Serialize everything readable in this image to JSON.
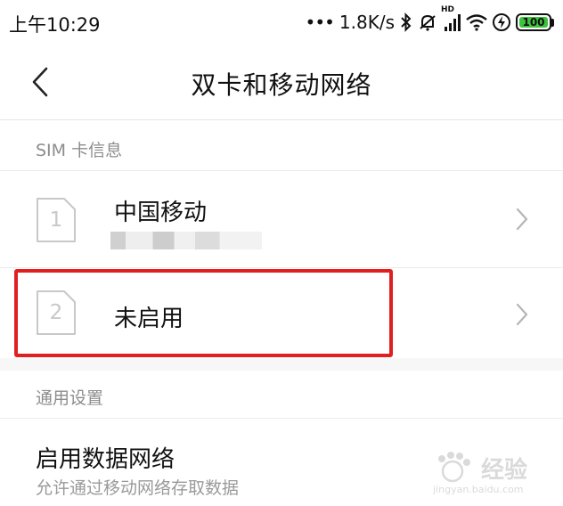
{
  "status_bar": {
    "time": "上午10:29",
    "network_speed": "1.8K/s",
    "signal_label": "HD",
    "battery_level": "100",
    "icons": [
      "dots-icon",
      "bluetooth-icon",
      "mute-icon",
      "signal-icon",
      "wifi-icon",
      "charging-icon",
      "battery-icon"
    ],
    "battery_color": "#3cc43c"
  },
  "header": {
    "title": "双卡和移动网络",
    "back_icon": "chevron-left-icon"
  },
  "sim_section": {
    "header": "SIM 卡信息",
    "cards": [
      {
        "slot": "1",
        "name": "中国移动"
      },
      {
        "slot": "2",
        "name": "未启用"
      }
    ]
  },
  "general_section": {
    "header": "通用设置",
    "items": [
      {
        "title": "启用数据网络",
        "subtitle": "允许通过移动网络存取数据"
      }
    ]
  },
  "highlight_color": "#e02020",
  "watermark": {
    "text": "经验",
    "url": "jingyan.baidu.com"
  }
}
